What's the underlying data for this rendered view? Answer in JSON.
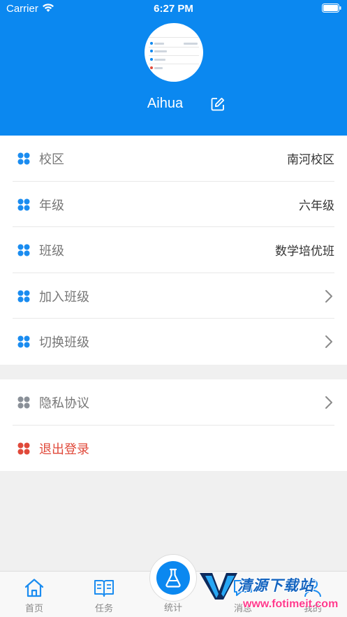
{
  "status_bar": {
    "carrier": "Carrier",
    "time": "6:27 PM"
  },
  "profile": {
    "name": "Aihua"
  },
  "menu_primary": [
    {
      "label": "校区",
      "value": "南河校区",
      "icon": "grid-icon",
      "icon_color": "#1a8cf0"
    },
    {
      "label": "年级",
      "value": "六年级",
      "icon": "grid-icon",
      "icon_color": "#1a8cf0"
    },
    {
      "label": "班级",
      "value": "数学培优班",
      "icon": "grid-icon",
      "icon_color": "#1a8cf0"
    },
    {
      "label": "加入班级",
      "value": "",
      "icon": "grid-icon",
      "icon_color": "#1a8cf0"
    },
    {
      "label": "切换班级",
      "value": "",
      "icon": "grid-icon",
      "icon_color": "#1a8cf0"
    }
  ],
  "menu_secondary": [
    {
      "label": "隐私协议",
      "icon": "grid-icon",
      "icon_color": "#8a9098"
    },
    {
      "label": "退出登录",
      "icon": "grid-icon",
      "icon_color": "#e0493a"
    }
  ],
  "tabs": [
    {
      "label": "首页",
      "icon": "home-icon"
    },
    {
      "label": "任务",
      "icon": "book-icon"
    },
    {
      "label": "统计",
      "icon": "flask-icon"
    },
    {
      "label": "消息",
      "icon": "message-icon"
    },
    {
      "label": "我的",
      "icon": "user-icon"
    }
  ],
  "watermark": {
    "title": "清源下载站",
    "url": "www.fotimeit.com"
  },
  "colors": {
    "accent": "#0b88f0",
    "danger": "#e0493a",
    "muted": "#8a9098"
  }
}
